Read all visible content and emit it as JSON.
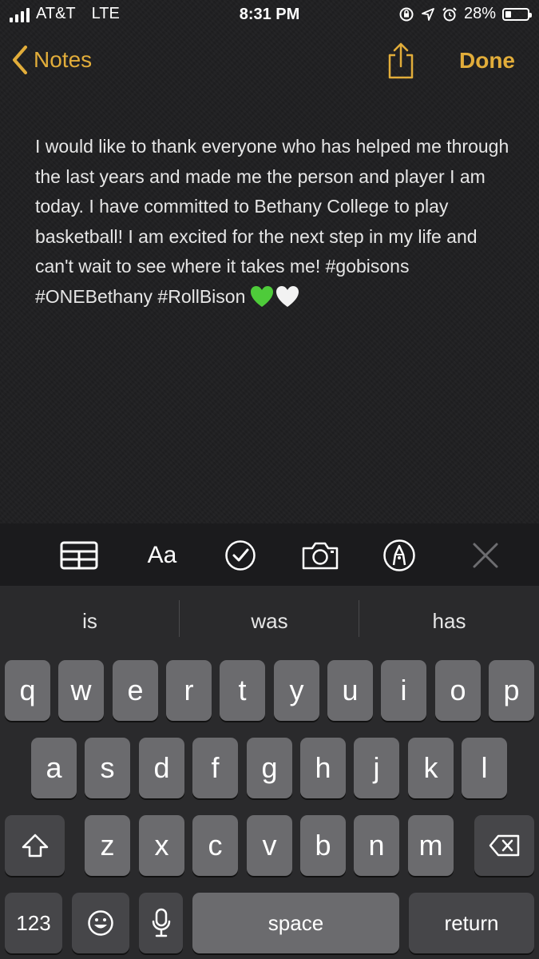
{
  "status_bar": {
    "carrier": "AT&T",
    "network": "LTE",
    "time": "8:31 PM",
    "battery_percent": "28%",
    "battery_level": 0.28,
    "icons": [
      "signal-bars-icon",
      "orientation-lock-icon",
      "location-icon",
      "alarm-icon",
      "battery-icon"
    ]
  },
  "nav": {
    "back_label": "Notes",
    "done_label": "Done",
    "accent_color": "#e2ad3a"
  },
  "note": {
    "text": "I would like to thank everyone who has helped me through the last years and made me the person and player I am today. I have committed to Bethany College to play basketball! I am excited for the next step in my life and can't wait to see where it takes me! #gobisons #ONEBethany #RollBison",
    "emoji": [
      "green-heart-icon",
      "white-heart-icon"
    ]
  },
  "toolbar": {
    "format_label": "Aa",
    "icons": [
      "table-icon",
      "format-text-icon",
      "checklist-icon",
      "camera-icon",
      "markup-pen-icon",
      "close-icon"
    ]
  },
  "keyboard": {
    "predictions": [
      "is",
      "was",
      "has"
    ],
    "row1": [
      "q",
      "w",
      "e",
      "r",
      "t",
      "y",
      "u",
      "i",
      "o",
      "p"
    ],
    "row2": [
      "a",
      "s",
      "d",
      "f",
      "g",
      "h",
      "j",
      "k",
      "l"
    ],
    "row3": [
      "z",
      "x",
      "c",
      "v",
      "b",
      "n",
      "m"
    ],
    "numbers_label": "123",
    "space_label": "space",
    "return_label": "return"
  }
}
